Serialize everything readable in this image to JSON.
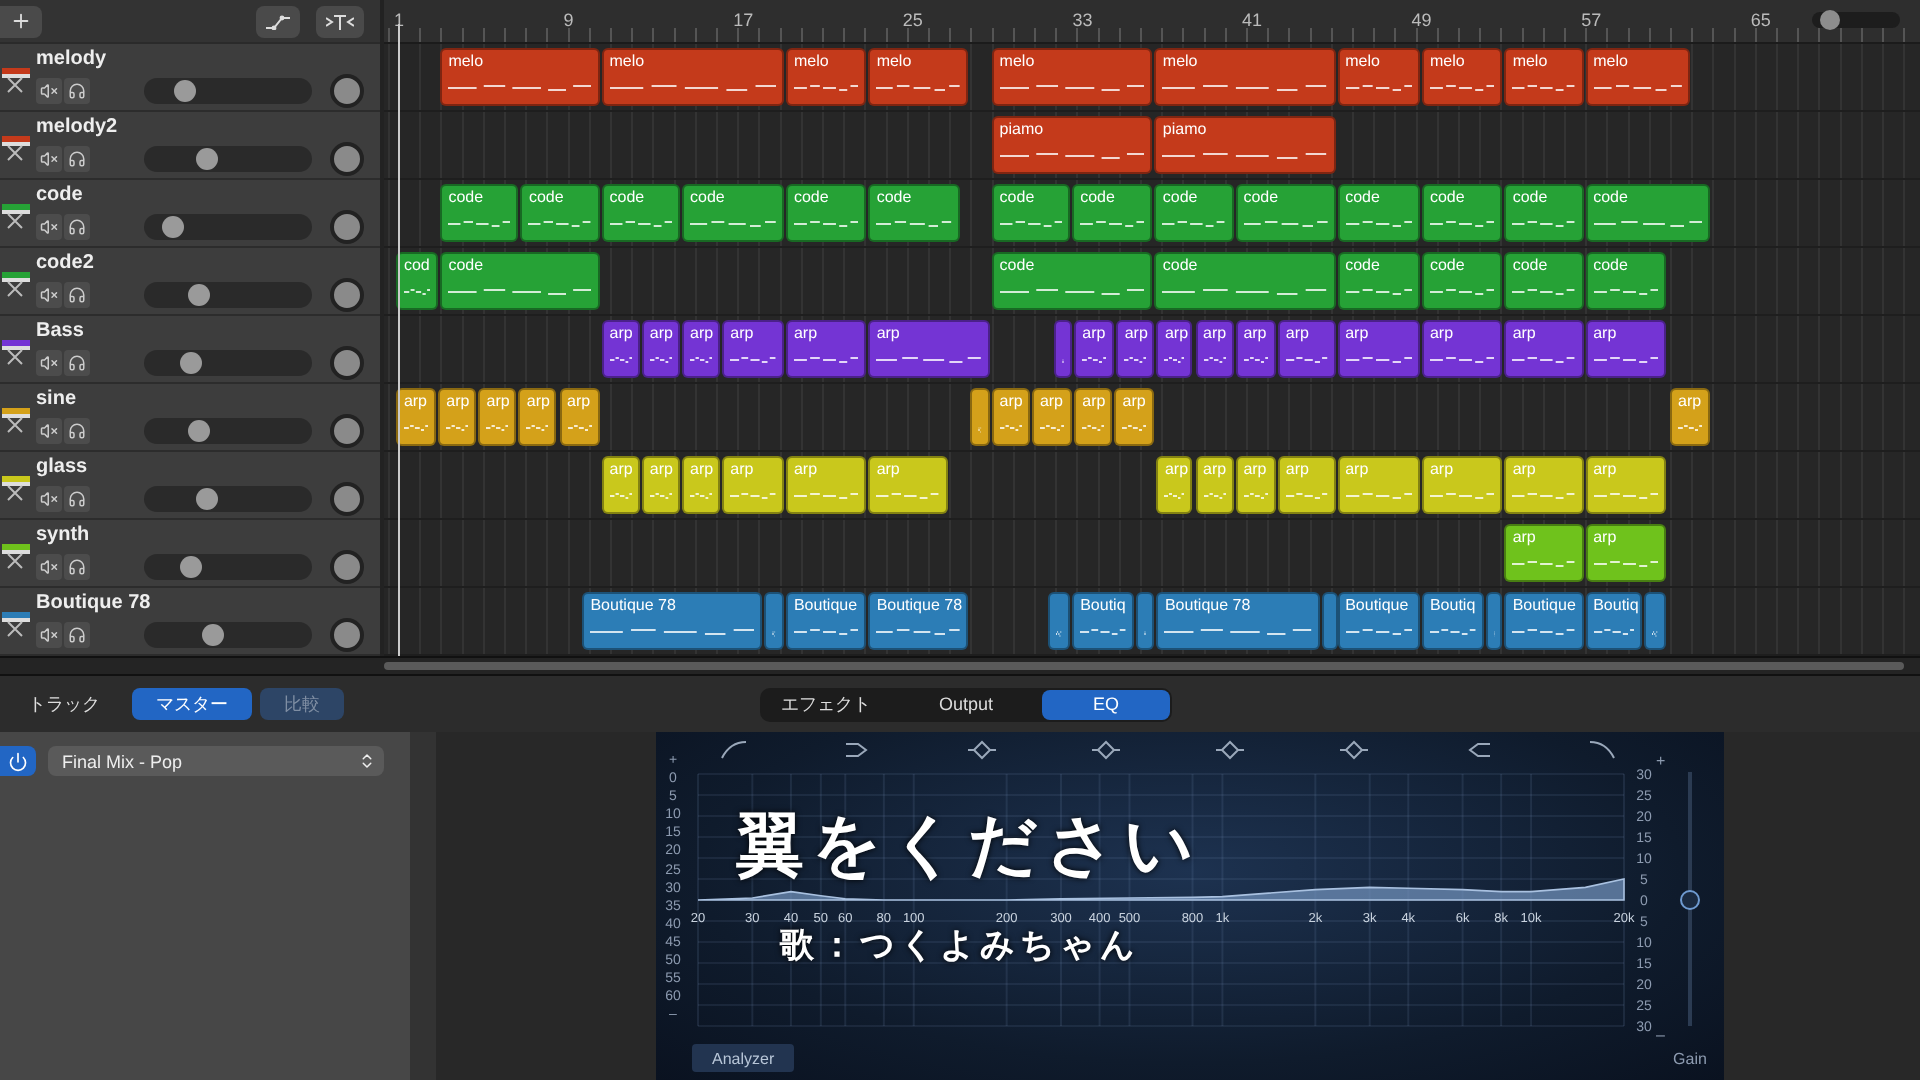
{
  "arrange": {
    "ruler": [
      "1",
      "9",
      "17",
      "25",
      "33",
      "41",
      "49",
      "57",
      "65"
    ],
    "zoom_slider": {
      "level": 0.12
    },
    "tracks": [
      {
        "name": "melody",
        "color": "#c43a1b",
        "volume": {
          "level": 0.2
        },
        "regions": [
          {
            "kind": "clip",
            "label": "melo"
          },
          {
            "kind": "clip",
            "label": "melo"
          },
          {
            "kind": "clip",
            "label": "melo"
          },
          {
            "kind": "clip",
            "label": "melo"
          },
          {
            "kind": "clip",
            "label": "melo"
          },
          {
            "kind": "clip",
            "label": "melo"
          },
          {
            "kind": "clip",
            "label": "melo"
          },
          {
            "kind": "clip",
            "label": "melo"
          },
          {
            "kind": "clip",
            "label": "melo"
          },
          {
            "kind": "clip",
            "label": "melo"
          }
        ]
      },
      {
        "name": "melody2",
        "color": "#c43a1b",
        "volume": {
          "level": 0.36
        },
        "regions": [
          {
            "kind": "clip",
            "label": "piamo"
          },
          {
            "kind": "clip",
            "label": "piamo"
          }
        ]
      },
      {
        "name": "code",
        "color": "#26a236",
        "volume": {
          "level": 0.13
        },
        "regions": [
          {
            "kind": "clip",
            "label": "code"
          },
          {
            "kind": "clip",
            "label": "code"
          },
          {
            "kind": "clip",
            "label": "code"
          },
          {
            "kind": "clip",
            "label": "code"
          },
          {
            "kind": "clip",
            "label": "code"
          },
          {
            "kind": "clip",
            "label": "code"
          },
          {
            "kind": "clip",
            "label": "code"
          },
          {
            "kind": "clip",
            "label": "code"
          },
          {
            "kind": "clip",
            "label": "code"
          },
          {
            "kind": "clip",
            "label": "code"
          },
          {
            "kind": "clip",
            "label": "code"
          },
          {
            "kind": "clip",
            "label": "code"
          },
          {
            "kind": "clip",
            "label": "code"
          },
          {
            "kind": "clip",
            "label": "code"
          }
        ]
      },
      {
        "name": "code2",
        "color": "#26a236",
        "volume": {
          "level": 0.3
        },
        "regions": [
          {
            "kind": "clip",
            "label": "cod"
          },
          {
            "kind": "clip",
            "label": "code"
          },
          {
            "kind": "clip",
            "label": "code"
          },
          {
            "kind": "clip",
            "label": "code"
          },
          {
            "kind": "clip",
            "label": "code"
          },
          {
            "kind": "clip",
            "label": "code"
          },
          {
            "kind": "clip",
            "label": "code"
          },
          {
            "kind": "clip",
            "label": "code"
          }
        ]
      },
      {
        "name": "Bass",
        "color": "#7434d4",
        "volume": {
          "level": 0.25
        },
        "regions": [
          {
            "kind": "clip",
            "label": "arp"
          },
          {
            "kind": "clip",
            "label": "arp"
          },
          {
            "kind": "clip",
            "label": "arp"
          },
          {
            "kind": "clip",
            "label": "arp"
          },
          {
            "kind": "clip",
            "label": "arp"
          },
          {
            "kind": "clip",
            "label": "arp"
          },
          {
            "kind": "stub"
          },
          {
            "kind": "clip",
            "label": "arp"
          },
          {
            "kind": "clip",
            "label": "arp"
          },
          {
            "kind": "clip",
            "label": "arp"
          },
          {
            "kind": "clip",
            "label": "arp"
          },
          {
            "kind": "clip",
            "label": "arp"
          },
          {
            "kind": "clip",
            "label": "arp"
          },
          {
            "kind": "clip",
            "label": "arp"
          },
          {
            "kind": "clip",
            "label": "arp"
          },
          {
            "kind": "clip",
            "label": "arp"
          },
          {
            "kind": "clip",
            "label": "arp"
          }
        ]
      },
      {
        "name": "sine",
        "color": "#d4a11a",
        "volume": {
          "level": 0.3
        },
        "regions": [
          {
            "kind": "clip",
            "label": "arp"
          },
          {
            "kind": "clip",
            "label": "arp"
          },
          {
            "kind": "clip",
            "label": "arp"
          },
          {
            "kind": "clip",
            "label": "arp"
          },
          {
            "kind": "clip",
            "label": "arp"
          },
          {
            "kind": "stub"
          },
          {
            "kind": "clip",
            "label": "arp"
          },
          {
            "kind": "clip",
            "label": "arp"
          },
          {
            "kind": "clip",
            "label": "arp"
          },
          {
            "kind": "clip",
            "label": "arp"
          },
          {
            "kind": "clip",
            "label": "arp"
          }
        ]
      },
      {
        "name": "glass",
        "color": "#c9c81c",
        "volume": {
          "level": 0.36
        },
        "regions": [
          {
            "kind": "clip",
            "label": "arp"
          },
          {
            "kind": "clip",
            "label": "arp"
          },
          {
            "kind": "clip",
            "label": "arp"
          },
          {
            "kind": "clip",
            "label": "arp"
          },
          {
            "kind": "clip",
            "label": "arp"
          },
          {
            "kind": "clip",
            "label": "arp"
          },
          {
            "kind": "clip",
            "label": "arp"
          },
          {
            "kind": "clip",
            "label": "arp"
          },
          {
            "kind": "clip",
            "label": "arp"
          },
          {
            "kind": "clip",
            "label": "arp"
          },
          {
            "kind": "clip",
            "label": "arp"
          },
          {
            "kind": "clip",
            "label": "arp"
          },
          {
            "kind": "clip",
            "label": "arp"
          },
          {
            "kind": "clip",
            "label": "arp"
          }
        ]
      },
      {
        "name": "synth",
        "color": "#6fc21c",
        "volume": {
          "level": 0.25
        },
        "regions": [
          {
            "kind": "clip",
            "label": "arp"
          },
          {
            "kind": "clip",
            "label": "arp"
          }
        ]
      },
      {
        "name": "Boutique 78",
        "color": "#2c7db6",
        "volume": {
          "level": 0.4
        },
        "regions": [
          {
            "kind": "clip",
            "label": "Boutique 78"
          },
          {
            "kind": "stub"
          },
          {
            "kind": "clip",
            "label": "Boutique"
          },
          {
            "kind": "clip",
            "label": "Boutique 78"
          },
          {
            "kind": "stub"
          },
          {
            "kind": "clip",
            "label": "Boutiq"
          },
          {
            "kind": "stub"
          },
          {
            "kind": "clip",
            "label": "Boutique 78"
          },
          {
            "kind": "stub"
          },
          {
            "kind": "clip",
            "label": "Boutique"
          },
          {
            "kind": "clip",
            "label": "Boutiq"
          },
          {
            "kind": "stub"
          },
          {
            "kind": "clip",
            "label": "Boutique"
          },
          {
            "kind": "clip",
            "label": "Boutiq"
          },
          {
            "kind": "stub"
          }
        ]
      }
    ]
  },
  "smart_controls": {
    "view_tabs": [
      {
        "label": "トラック",
        "selected": false
      },
      {
        "label": "マスター",
        "selected": true
      }
    ],
    "compare_button": {
      "label": "比較",
      "disabled": true
    },
    "tabs": [
      {
        "label": "エフェクト",
        "selected": false
      },
      {
        "label": "Output",
        "selected": false
      },
      {
        "label": "EQ",
        "selected": true
      }
    ],
    "power": {
      "on": true
    },
    "preset": {
      "value": "Final Mix - Pop"
    }
  },
  "eq": {
    "analyzer_scale": [
      "+",
      "0",
      "5",
      "10",
      "15",
      "20",
      "25",
      "30",
      "35",
      "40",
      "45",
      "50",
      "55",
      "60",
      "–"
    ],
    "gain_slider": {
      "top": "+",
      "bottom": "–",
      "label": "Gain",
      "level": 0.5
    },
    "analyzer_button": "Analyzer",
    "frequency_labels": [
      "20",
      "30",
      "40",
      "50",
      "60",
      "80",
      "100",
      "200",
      "300",
      "400",
      "500",
      "800",
      "1k",
      "2k",
      "3k",
      "4k",
      "6k",
      "8k",
      "10k",
      "20k"
    ],
    "gain_scale": [
      "30",
      "25",
      "20",
      "15",
      "10",
      "5",
      "0",
      "5",
      "10",
      "15",
      "20",
      "25",
      "30"
    ]
  },
  "subtitle": {
    "title": "翼をください",
    "credit": "歌：つくよみちゃん"
  }
}
